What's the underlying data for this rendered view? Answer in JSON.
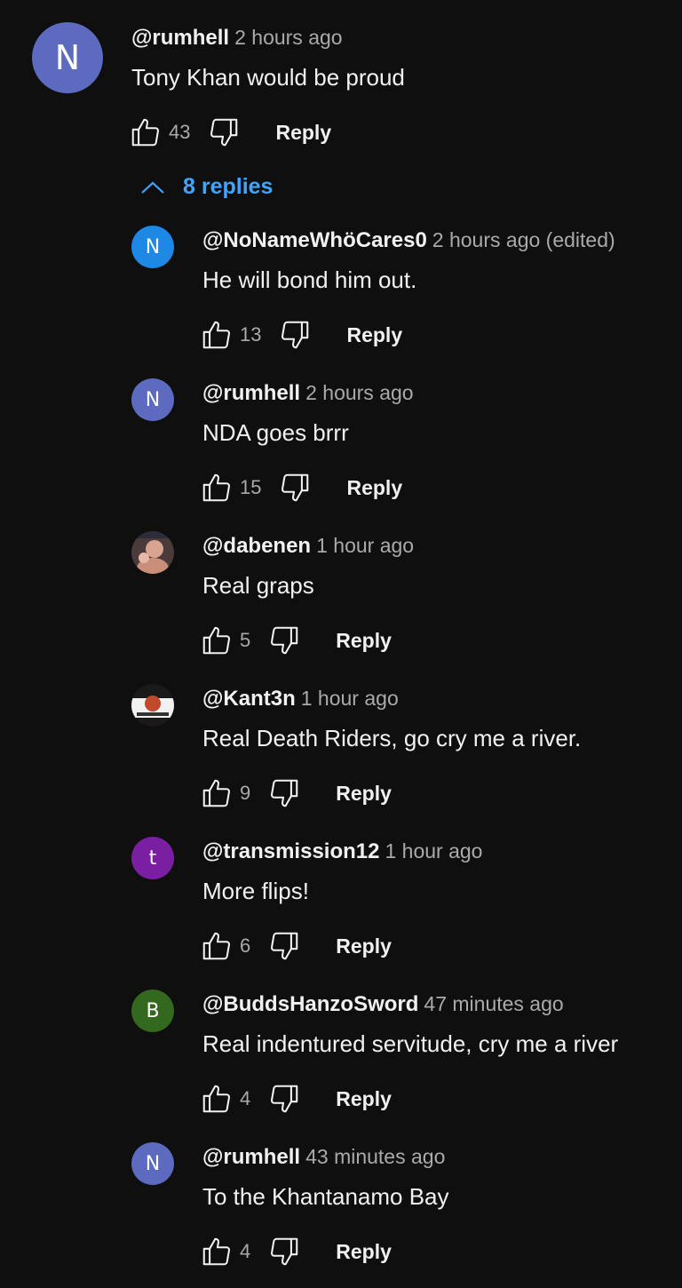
{
  "top_comment": {
    "avatar_letter": "N",
    "avatar_color": "#5c6bc0",
    "author": "@rumhell",
    "time": "2 hours ago",
    "text": "Tony Khan would be proud",
    "likes": "43",
    "reply_label": "Reply"
  },
  "replies_toggle": {
    "label": "8 replies",
    "icon": "chevron-up-icon"
  },
  "replies": [
    {
      "avatar_letter": "N",
      "avatar_color": "#1e88e5",
      "author": "@NoNameWhöCares0",
      "time": "2 hours ago (edited)",
      "text": "He will bond him out.",
      "likes": "13",
      "reply_label": "Reply"
    },
    {
      "avatar_letter": "N",
      "avatar_color": "#5c6bc0",
      "author": "@rumhell",
      "time": "2 hours ago",
      "text": "NDA goes brrr",
      "likes": "15",
      "reply_label": "Reply"
    },
    {
      "avatar_letter": "",
      "avatar_color": "#6b5a55",
      "author": "@dabenen",
      "time": "1 hour ago",
      "text": "Real graps",
      "likes": "5",
      "reply_label": "Reply"
    },
    {
      "avatar_letter": "",
      "avatar_color": "#222222",
      "author": "@Kant3n",
      "time": "1 hour ago",
      "text": "Real Death Riders, go cry me a river.",
      "likes": "9",
      "reply_label": "Reply"
    },
    {
      "avatar_letter": "t",
      "avatar_color": "#7b1fa2",
      "author": "@transmission12",
      "time": "1 hour ago",
      "text": "More flips!",
      "likes": "6",
      "reply_label": "Reply"
    },
    {
      "avatar_letter": "B",
      "avatar_color": "#33691e",
      "author": "@BuddsHanzoSword",
      "time": "47 minutes ago",
      "text": "Real indentured servitude, cry me a river",
      "likes": "4",
      "reply_label": "Reply"
    },
    {
      "avatar_letter": "N",
      "avatar_color": "#5c6bc0",
      "author": "@rumhell",
      "time": "43 minutes ago",
      "text": "To the Khantanamo Bay",
      "likes": "4",
      "reply_label": "Reply"
    }
  ]
}
